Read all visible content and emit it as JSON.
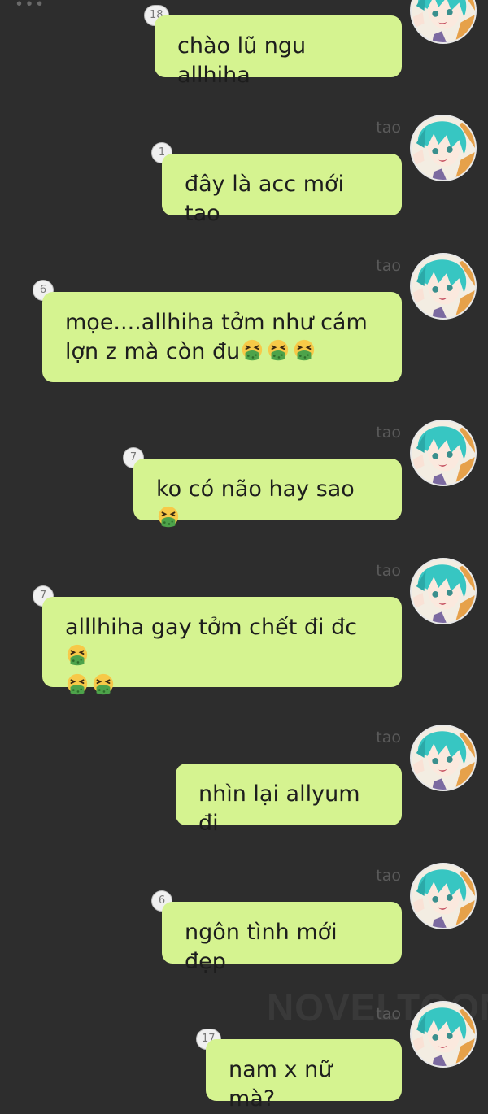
{
  "messages": [
    {
      "sender": "",
      "badge": "18",
      "text": "chào lũ ngu allhiha",
      "emoji_count": 0
    },
    {
      "sender": "tao",
      "badge": "1",
      "text": "đây là acc mới tao",
      "emoji_count": 0
    },
    {
      "sender": "tao",
      "badge": "6",
      "text_line1": "mọe....allhiha tởm như cám",
      "text_line2": "lợn z mà còn đu",
      "emoji": "nauseated-face-emoji"
    },
    {
      "sender": "tao",
      "badge": "7",
      "text": "ko có não hay sao",
      "emoji": "nauseated-face-emoji"
    },
    {
      "sender": "tao",
      "badge": "7",
      "text": "alllhiha gay tởm chết đi đc",
      "emoji": "nauseated-face-emoji"
    },
    {
      "sender": "tao",
      "text": "nhìn lại allyum đi"
    },
    {
      "sender": "tao",
      "badge": "6",
      "text": "ngôn tình mới đẹp"
    },
    {
      "sender": "tao",
      "badge": "17",
      "text": "nam x nữ mà?"
    }
  ],
  "watermark": "NOVELTOON",
  "colors": {
    "background": "#2d2d2d",
    "bubble": "#d5f390",
    "sender_label": "#5a5a5a",
    "badge_bg": "#f0f0f0"
  },
  "avatar_icon": "anime-girl-avatar-icon"
}
